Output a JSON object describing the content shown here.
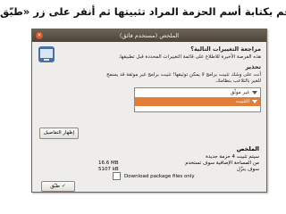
{
  "heading": "قم بكتابة أسم الحزمة المراد تثبيتها ثم أنقر على زر «طبّق»",
  "dialog": {
    "title": "الملخص (مستخدم فائق)",
    "section_title": "مراجعة التغييرات التالية؟",
    "intro_line1": "هذه الفرصة الأخيرة للاطلاع على قائمة التغييرات المحددة قبل تطبيقها.",
    "warning_title": "تحذير",
    "warning_line1": "أنت على وشك تثبيت برامج لا يمكن توثيقها! تثبيت برامج غير موثقة قد يسمح",
    "warning_line2": "للغير بالتلاعب بنظامك.",
    "list_items": [
      {
        "label": "غير موثّق"
      },
      {
        "label": "التثبيت"
      }
    ],
    "details_button": "إظهار التفاصيل",
    "summary_title": "الملخص",
    "summary_rows": [
      {
        "label": "سيتم تثبيت 4 حزمة جديدة",
        "value": ""
      },
      {
        "label": "من المساحة الإضافية سوف تستخدم",
        "value": "16.6 MB"
      },
      {
        "label": "سوف ينزّل",
        "value": "5107 kB"
      }
    ],
    "download_only_label": "Download package files only",
    "apply_button": "طبّق"
  }
}
